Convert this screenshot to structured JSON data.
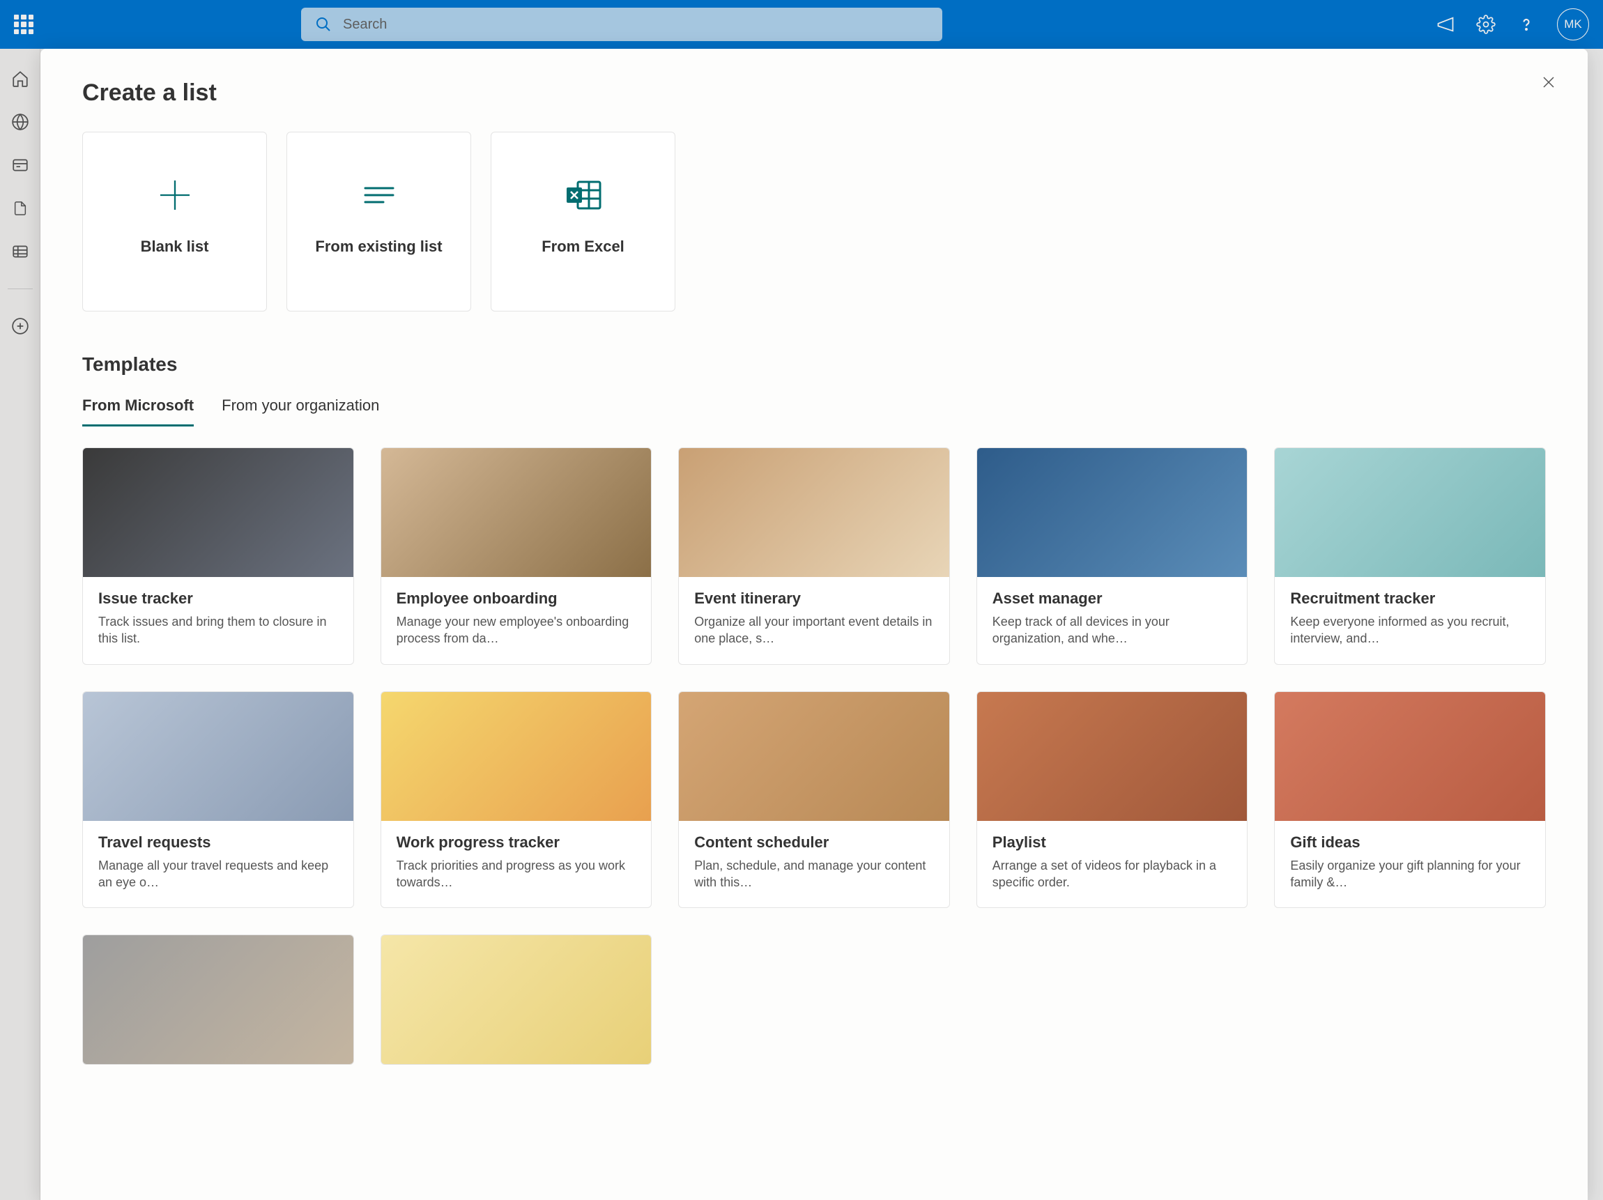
{
  "header": {
    "search_placeholder": "Search",
    "avatar_initials": "MK"
  },
  "modal": {
    "title": "Create a list",
    "templates_heading": "Templates",
    "create_options": [
      {
        "label": "Blank list",
        "icon": "plus"
      },
      {
        "label": "From existing list",
        "icon": "lines"
      },
      {
        "label": "From Excel",
        "icon": "excel"
      }
    ],
    "tabs": [
      {
        "label": "From Microsoft",
        "active": true
      },
      {
        "label": "From your organization",
        "active": false
      }
    ],
    "templates": [
      {
        "title": "Issue tracker",
        "desc": "Track issues and bring them to closure in this list.",
        "img": "img-1"
      },
      {
        "title": "Employee onboarding",
        "desc": "Manage your new employee's onboarding process from da…",
        "img": "img-2"
      },
      {
        "title": "Event itinerary",
        "desc": "Organize all your important event details in one place, s…",
        "img": "img-3"
      },
      {
        "title": "Asset manager",
        "desc": "Keep track of all devices in your organization, and whe…",
        "img": "img-4"
      },
      {
        "title": "Recruitment tracker",
        "desc": "Keep everyone informed as you recruit, interview, and…",
        "img": "img-5"
      },
      {
        "title": "Travel requests",
        "desc": "Manage all your travel requests and keep an eye o…",
        "img": "img-6"
      },
      {
        "title": "Work progress tracker",
        "desc": "Track priorities and progress as you work towards…",
        "img": "img-7"
      },
      {
        "title": "Content scheduler",
        "desc": "Plan, schedule, and manage your content with this…",
        "img": "img-8"
      },
      {
        "title": "Playlist",
        "desc": "Arrange a set of videos for playback in a specific order.",
        "img": "img-9"
      },
      {
        "title": "Gift ideas",
        "desc": "Easily organize your gift planning for your family &…",
        "img": "img-10"
      },
      {
        "title": "",
        "desc": "",
        "img": "img-11"
      },
      {
        "title": "",
        "desc": "",
        "img": "img-12"
      }
    ]
  }
}
